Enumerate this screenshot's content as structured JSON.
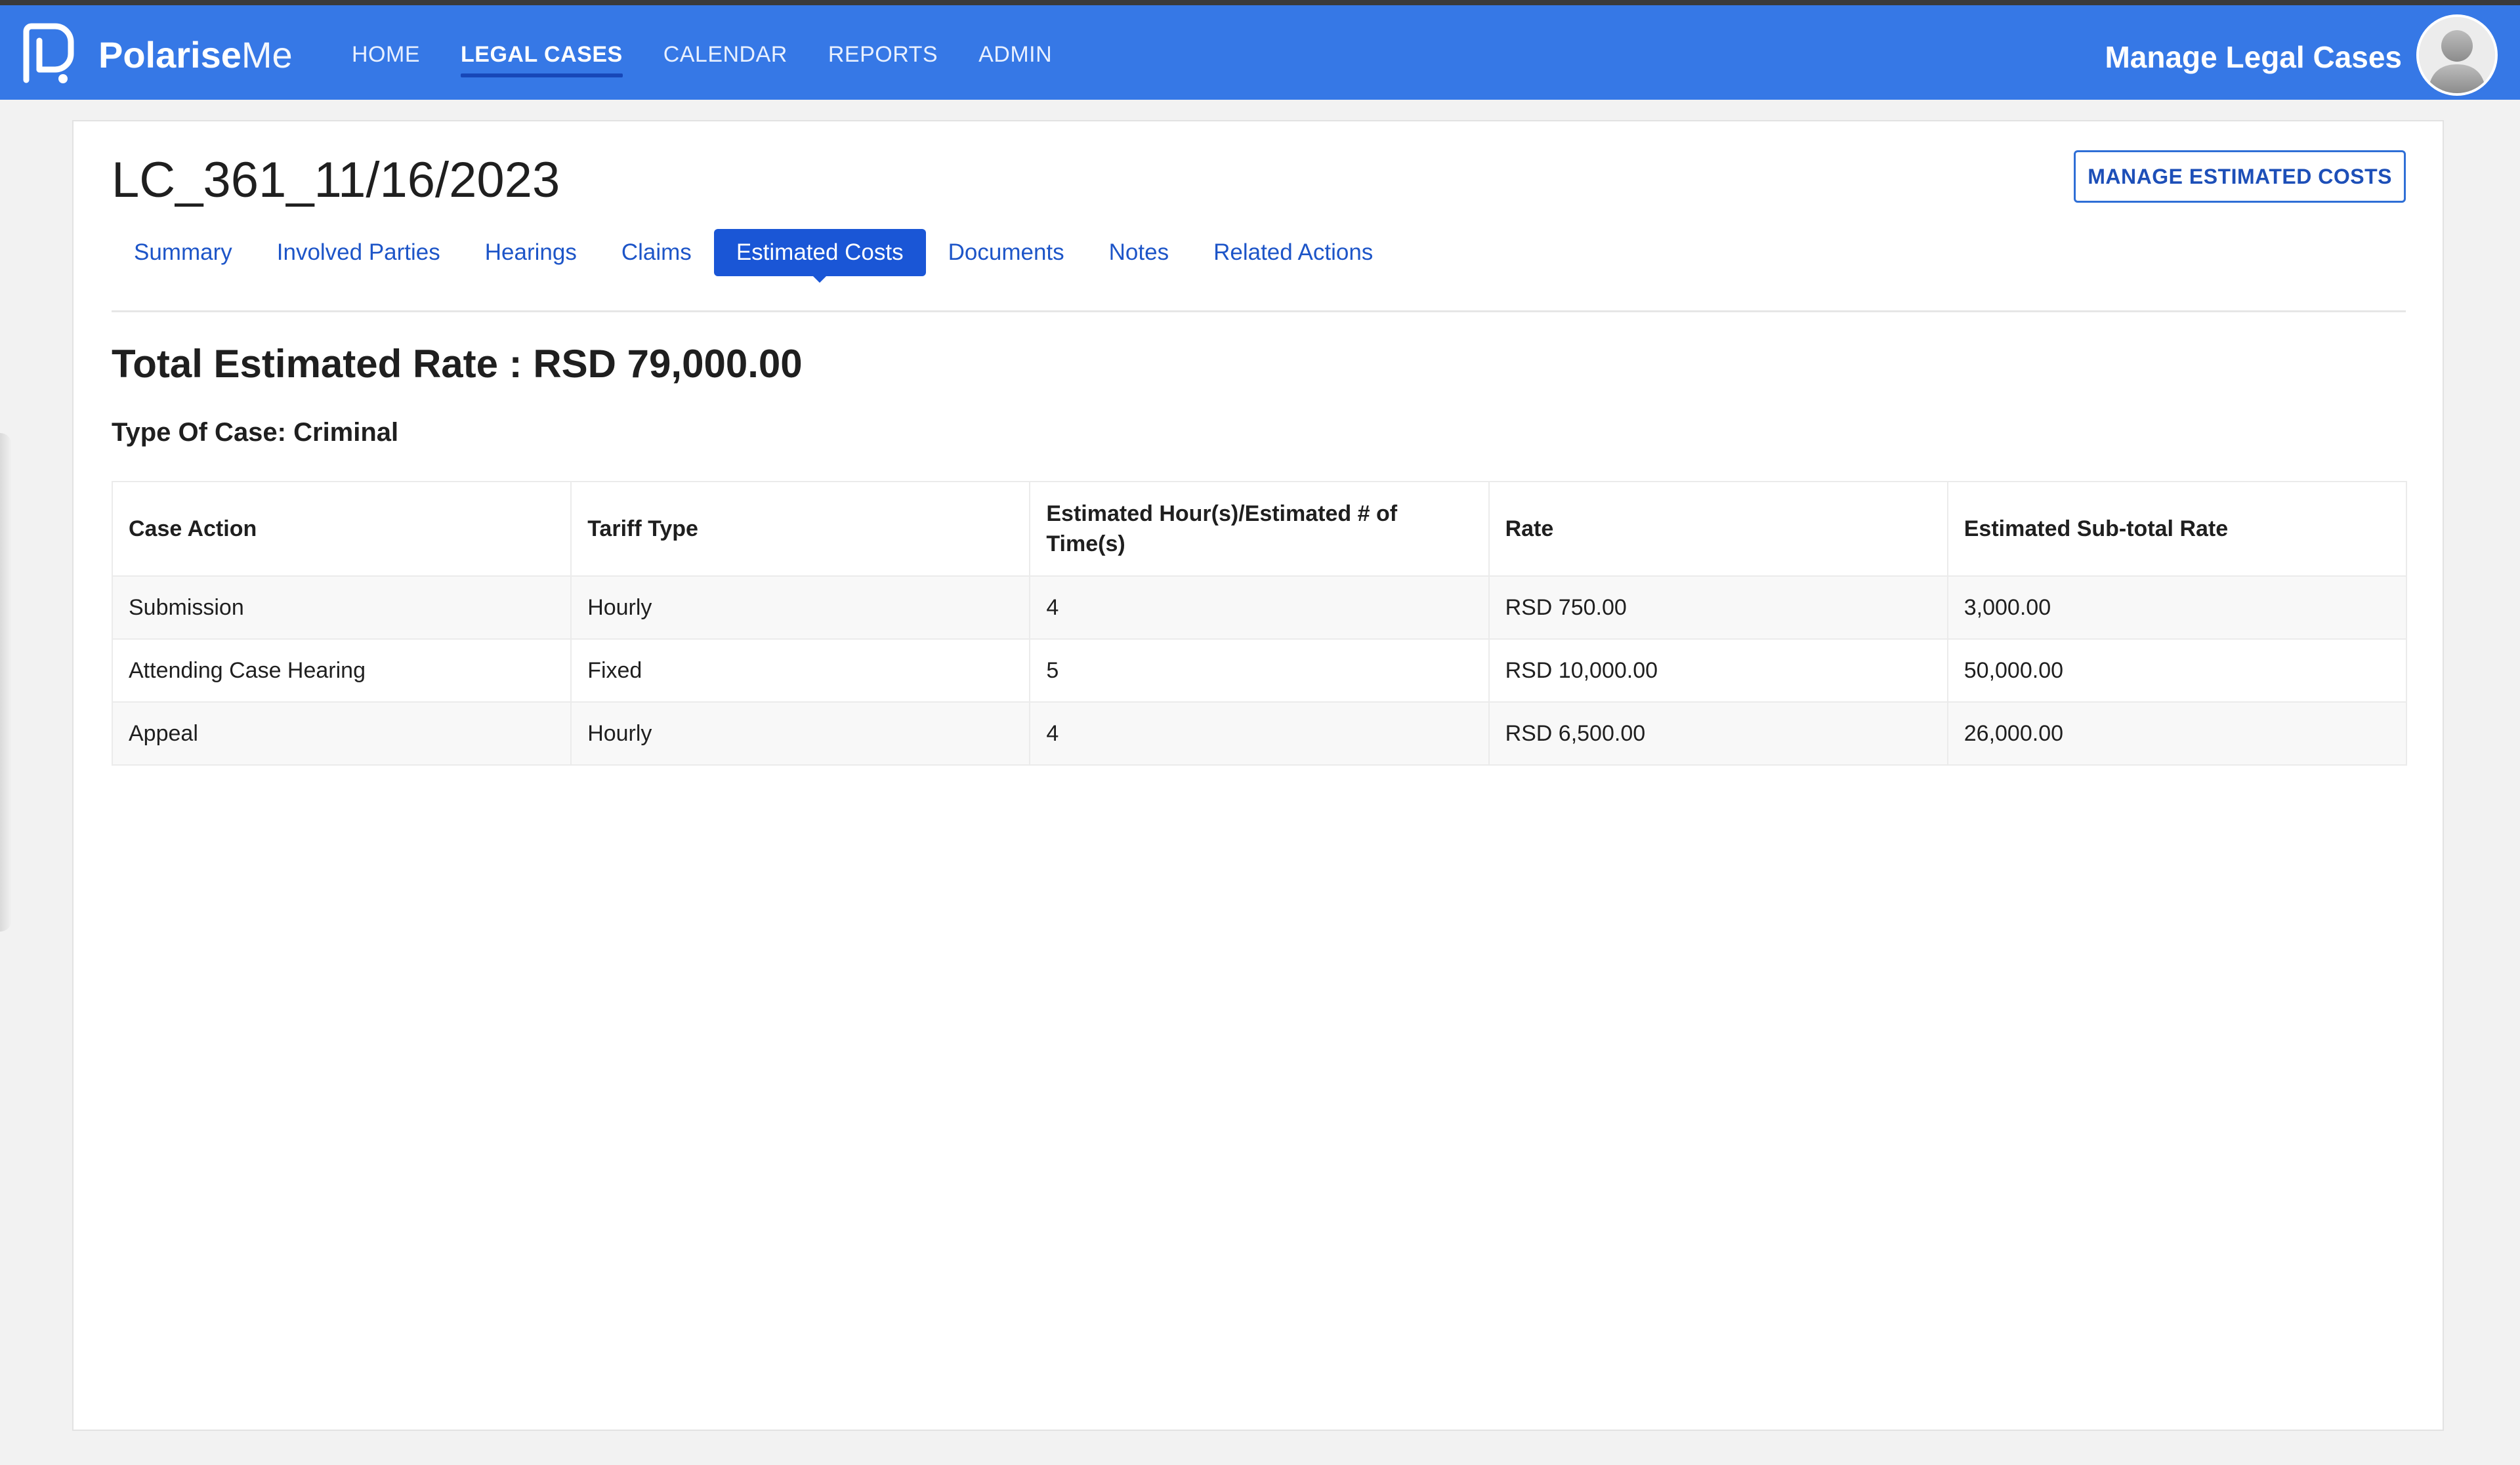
{
  "app": {
    "brand_bold": "Polarise",
    "brand_light": "Me",
    "page_label": "Manage Legal Cases"
  },
  "nav": {
    "items": [
      {
        "label": "HOME",
        "active": false
      },
      {
        "label": "LEGAL CASES",
        "active": true
      },
      {
        "label": "CALENDAR",
        "active": false
      },
      {
        "label": "REPORTS",
        "active": false
      },
      {
        "label": "ADMIN",
        "active": false
      }
    ]
  },
  "case": {
    "title": "LC_361_11/16/2023",
    "manage_button": "MANAGE ESTIMATED COSTS",
    "tabs": [
      {
        "label": "Summary",
        "active": false
      },
      {
        "label": "Involved Parties",
        "active": false
      },
      {
        "label": "Hearings",
        "active": false
      },
      {
        "label": "Claims",
        "active": false
      },
      {
        "label": "Estimated Costs",
        "active": true
      },
      {
        "label": "Documents",
        "active": false
      },
      {
        "label": "Notes",
        "active": false
      },
      {
        "label": "Related Actions",
        "active": false
      }
    ],
    "total_estimated_rate": "Total Estimated Rate : RSD 79,000.00",
    "type_of_case": "Type Of Case: Criminal"
  },
  "table": {
    "headers": [
      "Case Action",
      "Tariff Type",
      "Estimated Hour(s)/Estimated # of Time(s)",
      "Rate",
      "Estimated Sub-total Rate"
    ],
    "rows": [
      [
        "Submission",
        "Hourly",
        "4",
        "RSD 750.00",
        "3,000.00"
      ],
      [
        "Attending Case Hearing",
        "Fixed",
        "5",
        "RSD 10,000.00",
        "50,000.00"
      ],
      [
        "Appeal",
        "Hourly",
        "4",
        "RSD 6,500.00",
        "26,000.00"
      ]
    ]
  },
  "colors": {
    "navbar": "#3678e6",
    "active_tab": "#1a56d6",
    "link": "#1d55c8"
  }
}
